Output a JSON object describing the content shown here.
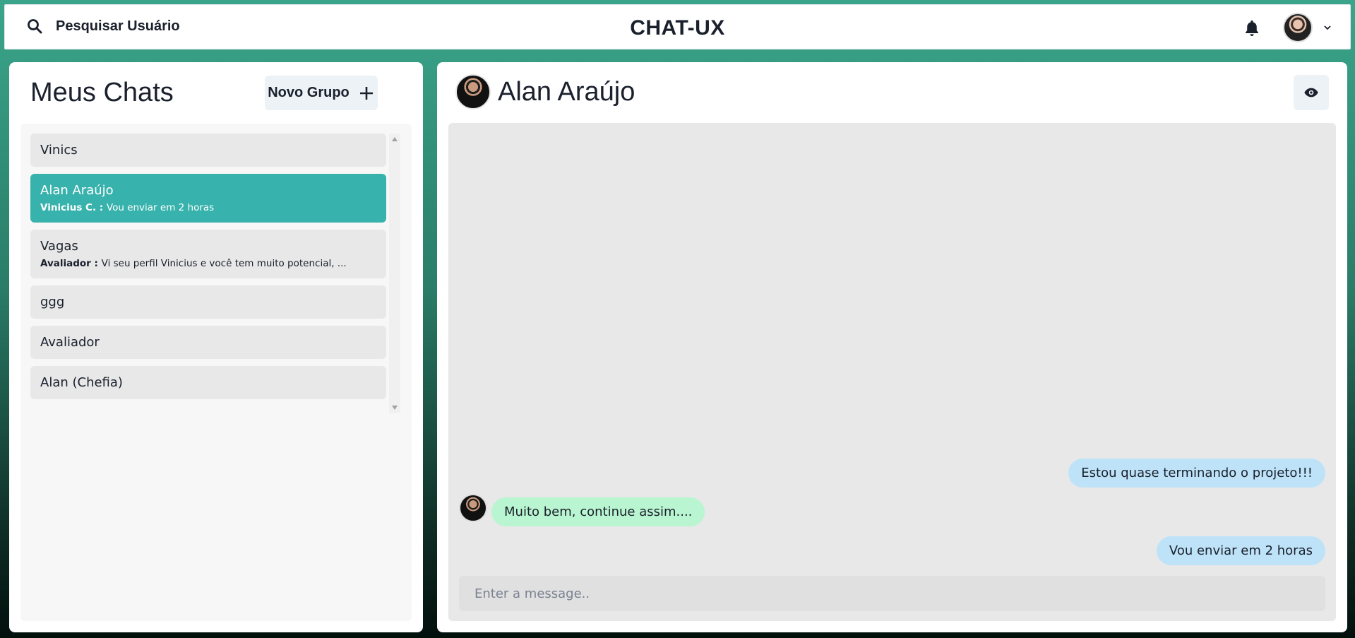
{
  "header": {
    "search_label": "Pesquisar Usuário",
    "app_title": "CHAT-UX",
    "search_icon": "search-icon",
    "bell_icon": "bell-icon",
    "chevron_icon": "chevron-down-icon"
  },
  "sidebar": {
    "title": "Meus Chats",
    "new_group_label": "Novo Grupo",
    "chats": [
      {
        "name": "Vinics",
        "sender": "",
        "preview": "",
        "active": false
      },
      {
        "name": "Alan Araújo",
        "sender": "Vinicius C. : ",
        "preview": "Vou enviar em 2 horas",
        "active": true
      },
      {
        "name": "Vagas",
        "sender": "Avaliador : ",
        "preview": "Vi seu perfil Vinicius e você tem muito potencial, ...",
        "active": false
      },
      {
        "name": "ggg",
        "sender": "",
        "preview": "",
        "active": false
      },
      {
        "name": "Avaliador",
        "sender": "",
        "preview": "",
        "active": false
      },
      {
        "name": "Alan (Chefia)",
        "sender": "",
        "preview": "",
        "active": false
      }
    ]
  },
  "chat": {
    "contact_name": "Alan Araújo",
    "messages": [
      {
        "text": "Estou quase terminando o projeto!!!",
        "direction": "sent"
      },
      {
        "text": "Muito bem, continue assim....",
        "direction": "received"
      },
      {
        "text": "Vou enviar em 2 horas",
        "direction": "sent"
      }
    ],
    "input_placeholder": "Enter a message.."
  },
  "colors": {
    "active_chat": "#38b2ac",
    "sent_bubble": "#bee3f8",
    "received_bubble": "#b9f5d0"
  }
}
